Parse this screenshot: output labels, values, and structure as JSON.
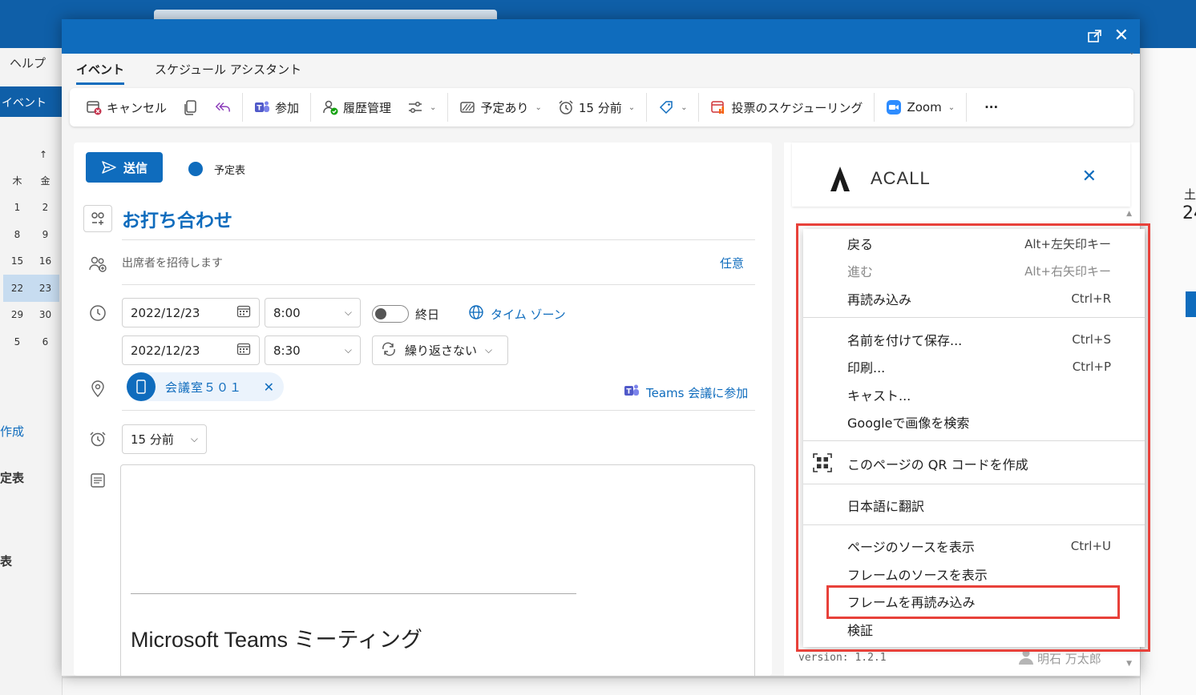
{
  "background": {
    "help_menu": "ヘルプ",
    "event_tab": "イベント",
    "calendar": {
      "up_arrow": "↑",
      "headers": [
        "木",
        "金"
      ],
      "rows": [
        [
          "1",
          "2"
        ],
        [
          "8",
          "9"
        ],
        [
          "15",
          "16"
        ],
        [
          "22",
          "23"
        ],
        [
          "29",
          "30"
        ],
        [
          "5",
          "6"
        ]
      ],
      "selected_row": 3
    },
    "left_labels": [
      "作成",
      "定表",
      "表"
    ],
    "right_labels": [
      "土",
      "24"
    ]
  },
  "dialog": {
    "tabs": [
      {
        "label": "イベント",
        "active": true
      },
      {
        "label": "スケジュール アシスタント",
        "active": false
      }
    ],
    "ribbon": {
      "cancel": "キャンセル",
      "join": "参加",
      "history": "履歴管理",
      "busy": "予定あり",
      "reminder": "15 分前",
      "poll": "投票のスケジューリング",
      "zoom": "Zoom",
      "more": "···"
    },
    "form": {
      "send": "送信",
      "calendar_name": "予定表",
      "title": "お打ち合わせ",
      "attendee_placeholder": "出席者を招待します",
      "optional": "任意",
      "start_date": "2022/12/23",
      "start_time": "8:00",
      "end_date": "2022/12/23",
      "end_time": "8:30",
      "all_day": "終日",
      "time_zone": "タイム ゾーン",
      "repeat": "繰り返さない",
      "room": "会議室５０１",
      "teams_join": "Teams 会議に参加",
      "reminder": "15 分前",
      "body_heading": "Microsoft Teams ミーティング"
    }
  },
  "acall": {
    "name": "ACALL",
    "version": "version: 1.2.1",
    "user": "明石 万太郎"
  },
  "context_menu": {
    "items": [
      {
        "label": "戻る",
        "shortcut": "Alt+左矢印キー",
        "disabled": false
      },
      {
        "label": "進む",
        "shortcut": "Alt+右矢印キー",
        "disabled": true
      },
      {
        "label": "再読み込み",
        "shortcut": "Ctrl+R",
        "disabled": false
      },
      {
        "label": "名前を付けて保存...",
        "shortcut": "Ctrl+S",
        "disabled": false
      },
      {
        "label": "印刷...",
        "shortcut": "Ctrl+P",
        "disabled": false
      },
      {
        "label": "キャスト...",
        "shortcut": "",
        "disabled": false
      },
      {
        "label": "Googleで画像を検索",
        "shortcut": "",
        "disabled": false
      },
      {
        "label": "このページの QR コードを作成",
        "shortcut": "",
        "disabled": false
      },
      {
        "label": "日本語に翻訳",
        "shortcut": "",
        "disabled": false
      },
      {
        "label": "ページのソースを表示",
        "shortcut": "Ctrl+U",
        "disabled": false
      },
      {
        "label": "フレームのソースを表示",
        "shortcut": "",
        "disabled": false
      },
      {
        "label": "フレームを再読み込み",
        "shortcut": "",
        "disabled": false,
        "highlighted": true
      },
      {
        "label": "検証",
        "shortcut": "",
        "disabled": false
      }
    ]
  },
  "colors": {
    "brand": "#0f6cbd",
    "highlight": "#e8413a"
  }
}
